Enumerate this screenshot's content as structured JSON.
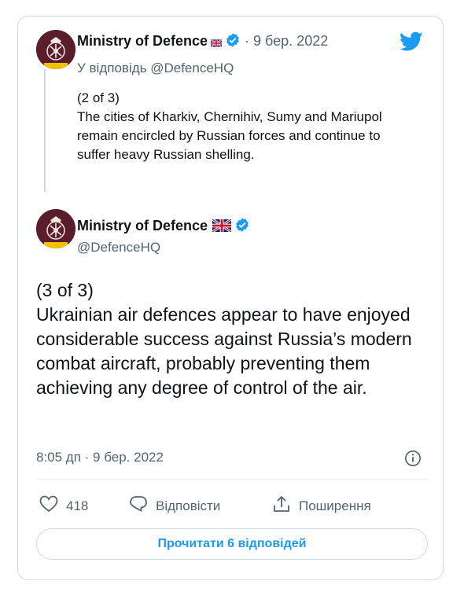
{
  "colors": {
    "accent": "#1d9bf0",
    "muted": "#536471",
    "text": "#0f1419",
    "avatar": "#5a1d2c",
    "border": "#cfd9de"
  },
  "quoted_tweet": {
    "author_name": "Ministry of Defence",
    "flag_icon": "uk-flag-icon",
    "separator": " · ",
    "date": "9 бер. 2022",
    "reply_to": "У відповідь @DefenceHQ",
    "text": "(2 of 3)\nThe cities of Kharkiv, Chernihiv, Sumy and Mariupol remain encircled by Russian forces and continue to suffer heavy Russian shelling."
  },
  "main_tweet": {
    "author_name": "Ministry of Defence",
    "handle": "@DefenceHQ",
    "text": "(3 of 3)\nUkrainian air defences appear to have enjoyed considerable success against Russia’s modern combat aircraft, probably preventing them achieving any degree of control of the air.",
    "timestamp": "8:05 дп · 9 бер. 2022",
    "likes": "418",
    "reply_label": "Відповісти",
    "share_label": "Поширення",
    "read_replies": "Прочитати 6 відповідей"
  }
}
